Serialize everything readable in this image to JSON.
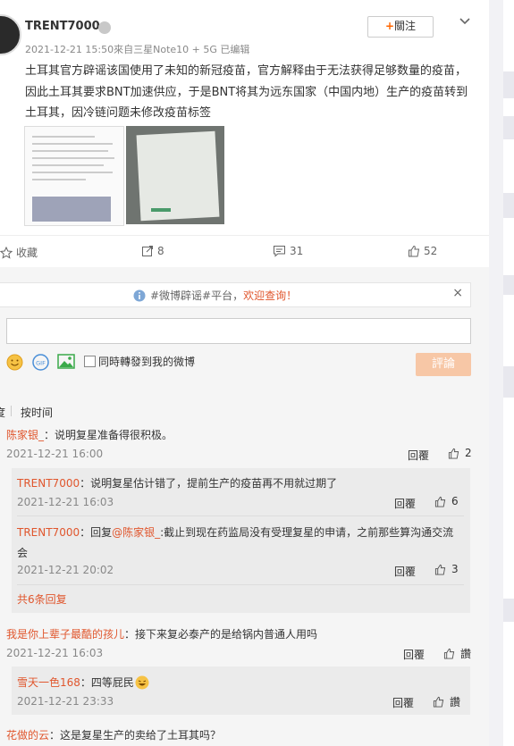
{
  "post": {
    "username": "TRENT7000",
    "meta": "2021-12-21 15:50來自三星Note10 + 5G  已编辑",
    "follow_label": "關注",
    "text": "土耳其官方辟谣该国使用了未知的新冠疫苗，官方解释由于无法获得足够数量的疫苗，因此土耳其要求BNT加速供应，于是BNT将其为远东国家（中国内地）生产的疫苗转到土耳其，因冷链问题未修改疫苗标签"
  },
  "actions": {
    "favorite": "收藏",
    "repost": "8",
    "comment": "31",
    "like": "52"
  },
  "notice": {
    "prefix": "#微博辟谣#平台，",
    "highlight": "欢迎查询！",
    "close": "×"
  },
  "compose": {
    "repost_checkbox": "同時轉發到我的微博",
    "submit": "評論"
  },
  "sort": {
    "left": "度",
    "time": "按时间"
  },
  "comments": [
    {
      "name": "陈家银_",
      "text": "：说明复星准备得很积极。",
      "time": "2021-12-21 16:00",
      "reply": "回覆",
      "likes": "2",
      "replies": [
        {
          "name": "TRENT7000",
          "text": "：说明复星估计错了，提前生产的疫苗再不用就过期了",
          "time": "2021-12-21 16:03",
          "reply": "回覆",
          "likes": "6"
        },
        {
          "name": "TRENT7000",
          "text_pre": "：回复",
          "mention": "@陈家银_",
          "text": ":截止到现在药监局没有受理复星的申请，之前那些算沟通交流会",
          "time": "2021-12-21 20:02",
          "reply": "回覆",
          "likes": "3"
        }
      ],
      "more": "共6条回复"
    },
    {
      "name": "我是你上辈子最酷的孩儿",
      "text": "：接下来复必泰产的是给锅内普通人用吗",
      "time": "2021-12-21 16:03",
      "reply": "回覆",
      "likes": "讚",
      "replies": [
        {
          "name": "雪天一色168",
          "text": "：四等屁民",
          "time": "2021-12-21 23:33",
          "reply": "回覆",
          "likes": "讚"
        }
      ]
    },
    {
      "name": "花做的云",
      "text": "：这是复星生产的卖给了土耳其吗？"
    }
  ],
  "colors": {
    "accent": "#e0562d",
    "submit_bg": "#f7c7a6"
  }
}
